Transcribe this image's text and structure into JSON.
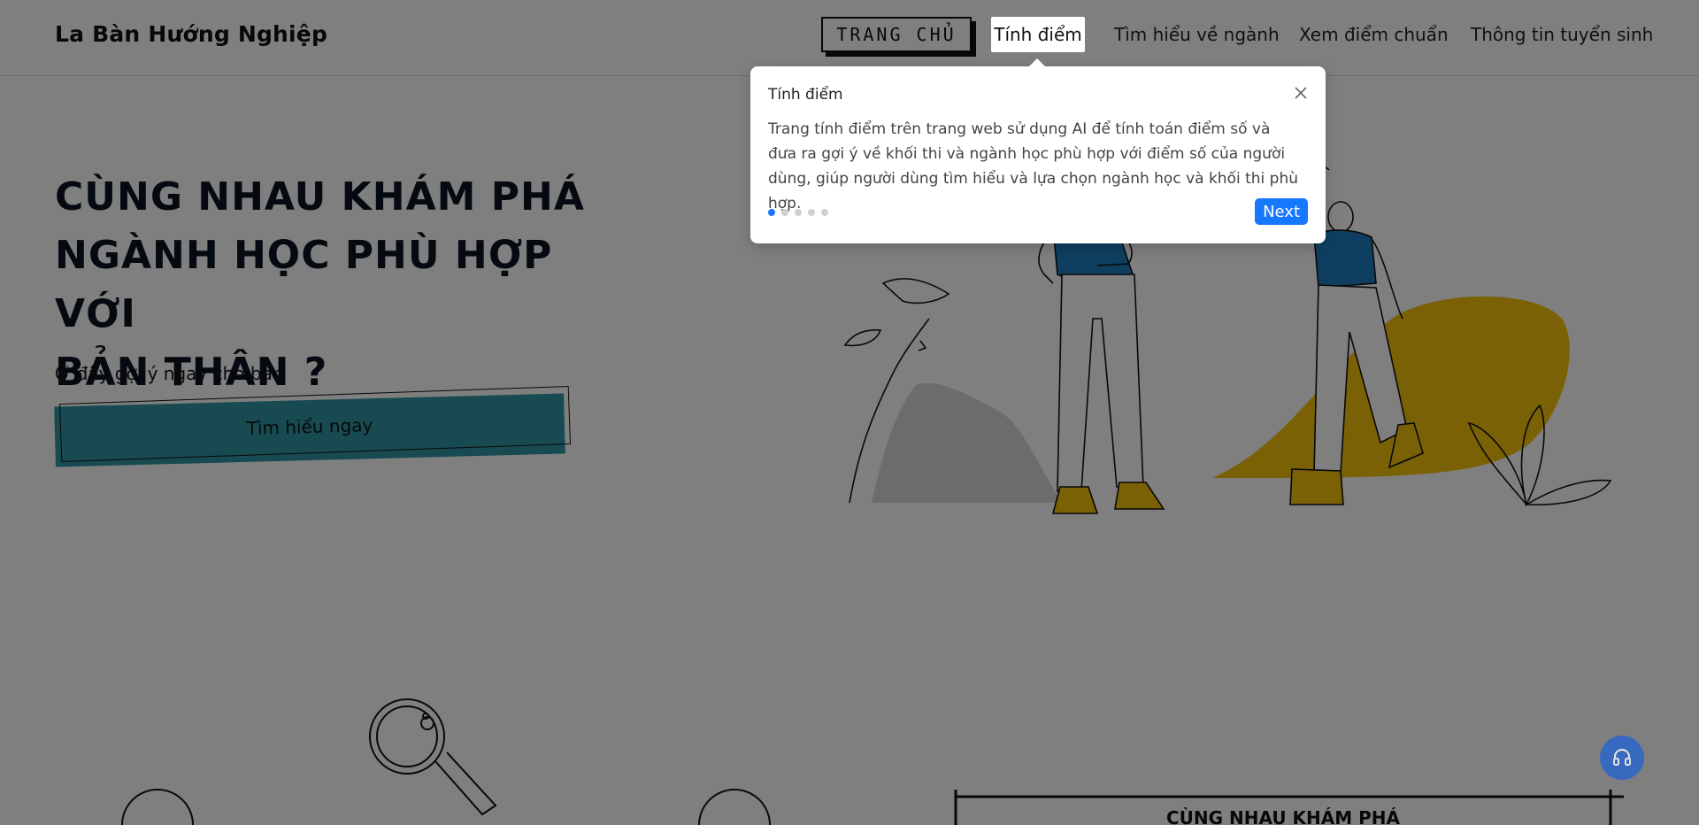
{
  "header": {
    "logo": "La Bàn Hướng Nghiệp",
    "nav": {
      "home": "TRANG CHỦ",
      "score": "Tính điểm",
      "majors": "Tìm hiểu về ngành",
      "benchmark": "Xem điểm chuẩn",
      "admissions": "Thông tin tuyển sinh"
    }
  },
  "hero": {
    "title_line1": "CÙNG NHAU KHÁM PHÁ",
    "title_line2": "NGÀNH HỌC PHÙ HỢP VỚI",
    "title_line3": "BẢN THÂN ?",
    "subtitle": "Ở đây gợi ý ngay cho bạn",
    "cta_label": "Tìm hiểu ngay"
  },
  "lower": {
    "banner_text": "CÙNG NHAU KHÁM PHÁ"
  },
  "tour": {
    "title": "Tính điểm",
    "body": "Trang tính điểm trên trang web sử dụng AI để tính toán điểm số và đưa ra gợi ý về khối thi và ngành học phù hợp với điểm số của người dùng, giúp người dùng tìm hiểu và lựa chọn ngành học và khối thi phù hợp.",
    "next_label": "Next",
    "steps_total": 5,
    "current_step": 1,
    "close_icon": "close-icon"
  },
  "fab": {
    "icon": "headset-icon"
  },
  "colors": {
    "accent_blue": "#1677ff",
    "cta_teal": "#2e95a3",
    "shirt_blue": "#1e7fc0",
    "shoe_yellow": "#f4c20d"
  }
}
